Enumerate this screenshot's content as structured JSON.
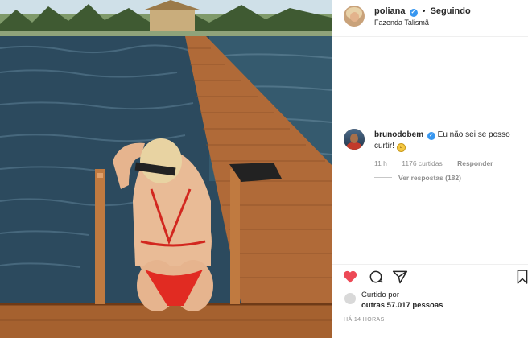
{
  "post": {
    "image_alt": "Woman in red bikini sitting on wooden pier by the lake",
    "owner": {
      "username": "poliana",
      "separator": "•",
      "follow_status": "Seguindo",
      "location": "Fazenda Talismã"
    }
  },
  "comment": {
    "username": "brunodobem",
    "text": "Eu não sei se posso curtir!",
    "emoji": "😅",
    "time": "11 h",
    "likes": "1176 curtidas",
    "reply_label": "Responder",
    "view_replies": "Ver respostas (182)"
  },
  "actions": {
    "like_icon": "heart-filled-icon",
    "comment_icon": "comment-icon",
    "share_icon": "share-icon",
    "save_icon": "bookmark-icon",
    "like_color": "#ed4956"
  },
  "likes": {
    "prefix": "Curtido por",
    "count": "outras 57.017 pessoas"
  },
  "timestamp": "HÁ 14 HORAS"
}
